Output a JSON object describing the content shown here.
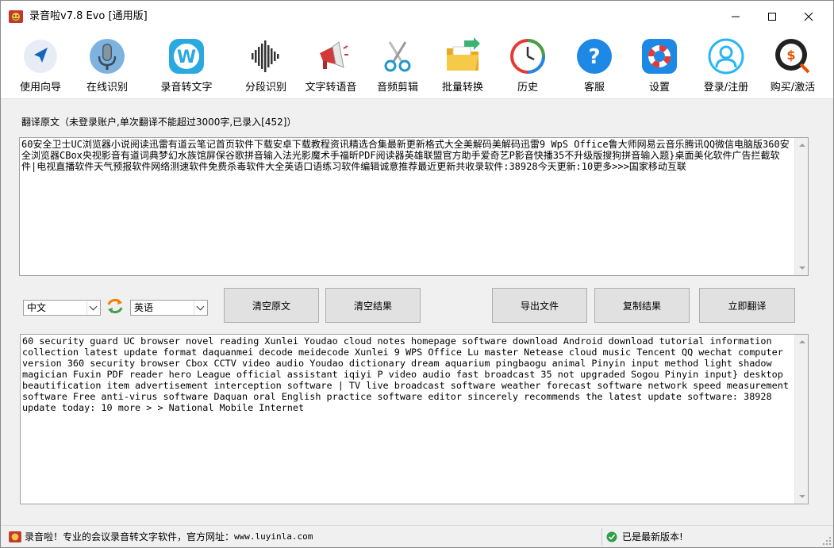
{
  "window": {
    "title": "录音啦v7.8 Evo [通用版]"
  },
  "toolbar": {
    "items": [
      {
        "label": "使用向导",
        "icon": "navigation-arrow-icon"
      },
      {
        "label": "在线识别",
        "icon": "microphone-icon"
      },
      {
        "label": "录音转文字",
        "icon": "w-app-icon"
      },
      {
        "label": "分段识别",
        "icon": "waveform-icon"
      },
      {
        "label": "文字转语音",
        "icon": "megaphone-icon"
      },
      {
        "label": "音频剪辑",
        "icon": "scissors-icon"
      },
      {
        "label": "批量转换",
        "icon": "folder-icon"
      },
      {
        "label": "历史",
        "icon": "history-clock-icon"
      },
      {
        "label": "客服",
        "icon": "help-icon"
      },
      {
        "label": "设置",
        "icon": "lifebuoy-icon"
      },
      {
        "label": "登录/注册",
        "icon": "user-icon"
      },
      {
        "label": "购买/激活",
        "icon": "purchase-icon"
      }
    ]
  },
  "translate": {
    "source_label": "翻译原文（未登录账户,单次翻译不能超过3000字,已录入[452]）",
    "source_text": "60安全卫士UC浏览器小说阅读迅雷有道云笔记首页软件下载安卓下载教程资讯精选合集最新更新格式大全美解码美解码迅雷9 WpS Office鲁大师网易云音乐腾讯QQ微信电脑版360安全浏览器CBox央视影音有道词典梦幻水族馆屏保谷歌拼音输入法光影魔术手福昕PDF阅读器英雄联盟官方助手爱奇艺P影音快播35不升级版搜狗拼音输入题}桌面美化软件广告拦截软件|电视直播软件天气预报软件网络测速软件免费杀毒软件大全英语口语练习软件编辑诚意推荐最近更新共收录软件:38928今天更新:10更多>>>国家移动互联",
    "from_lang": "中文",
    "to_lang": "英语",
    "buttons": {
      "clear_source": "清空原文",
      "clear_result": "清空结果",
      "export_file": "导出文件",
      "copy_result": "复制结果",
      "translate_now": "立即翻译"
    },
    "result_text": "60 security guard UC browser novel reading Xunlei Youdao cloud notes homepage software download Android download tutorial information collection latest update format daquanmei decode meidecode Xunlei 9 WPS Office Lu master Netease cloud music Tencent QQ wechat computer version 360 security browser Cbox CCTV video audio Youdao dictionary dream aquarium pingbaogu animal Pinyin input method light shadow magician Fuxin PDF reader hero League official assistant iqiyi P video audio fast broadcast 35 not upgraded Sogou Pinyin input} desktop beautification item advertisement interception software | TV live broadcast software weather forecast software network speed measurement software Free anti-virus software Daquan oral English practice software editor sincerely recommends the latest update software: 38928 update today: 10 more > > National Mobile Internet"
  },
  "statusbar": {
    "left_text": "录音啦！专业的会议录音转文字软件，官方网址：",
    "site": "www.luyinla.com",
    "right_text": "已是最新版本!"
  },
  "colors": {
    "accent_blue": "#1e88e5",
    "status_green": "#2e9e4a"
  }
}
